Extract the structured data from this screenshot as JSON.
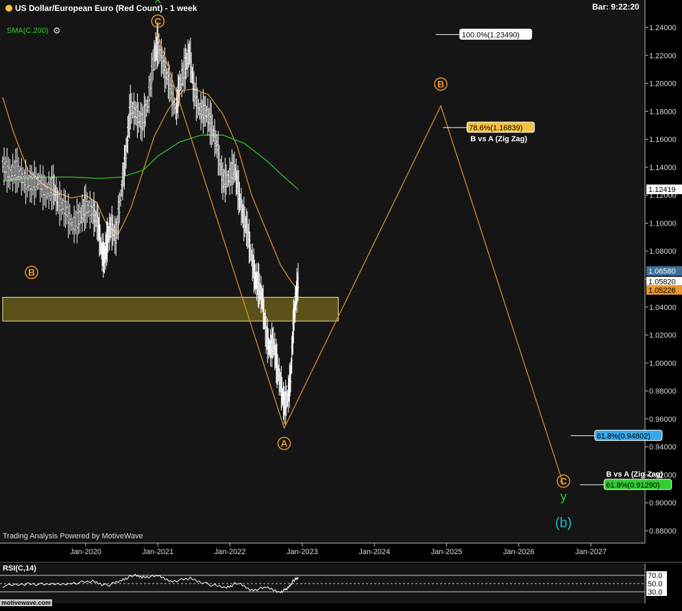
{
  "header": {
    "title": "US Dollar/European Euro (Red Count) - 1 week",
    "bar_time": "Bar: 9:22:20",
    "sma_label": "SMA(C,200)",
    "credit": "Trading Analysis Powered by MotiveWave",
    "logo": "motivewave.com"
  },
  "colors": {
    "background": "#151515",
    "price_bars": "#ffffff",
    "orange_ma": "#e8962e",
    "sma200": "#2db82d",
    "wave_lines": "#e8962e",
    "zone_fill": "#5a5218",
    "zone_border": "#f0e890",
    "accent_green": "#33cc33",
    "accent_cyan": "#22b8c8"
  },
  "chart_data": {
    "type": "line",
    "x_axis_ticks": [
      "Jan-2020",
      "Jan-2021",
      "Jan-2022",
      "Jan-2023",
      "Jan-2024",
      "Jan-2025",
      "Jan-2026",
      "Jan-2027"
    ],
    "y_axis_ticks": [
      "0.88000",
      "0.90000",
      "0.92000",
      "0.94000",
      "0.96000",
      "0.98000",
      "1.00000",
      "1.02000",
      "1.04000",
      "1.06000",
      "1.08000",
      "1.10000",
      "1.12000",
      "1.14000",
      "1.16000",
      "1.18000",
      "1.20000",
      "1.22000",
      "1.24000"
    ],
    "ylim": [
      0.868,
      1.258
    ],
    "price_tags": [
      {
        "label": "1.12419",
        "value": 1.12419,
        "bg": "#ffffff",
        "fg": "#000000"
      },
      {
        "label": "1.06580",
        "value": 1.0658,
        "bg": "#3a6f9a",
        "fg": "#ffffff"
      },
      {
        "label": "1.05820",
        "value": 1.0582,
        "bg": "#ffffff",
        "fg": "#000000"
      },
      {
        "label": "1.05226",
        "value": 1.05226,
        "bg": "#e8962e",
        "fg": "#000000"
      }
    ],
    "wave_path": [
      {
        "date": 2021.0,
        "value": 1.2349
      },
      {
        "date": 2022.75,
        "value": 0.9535
      },
      {
        "date": 2024.92,
        "value": 1.1839
      },
      {
        "date": 2026.62,
        "value": 0.9129
      }
    ],
    "wave_labels": [
      {
        "text": "C",
        "date": 2021.0,
        "value": 1.2445,
        "pos": "above"
      },
      {
        "text": "B",
        "date": 2019.25,
        "value": 1.0648,
        "pos": "below"
      },
      {
        "text": "A",
        "date": 2022.75,
        "value": 0.9425,
        "pos": "below"
      },
      {
        "text": "B",
        "date": 2024.92,
        "value": 1.1995,
        "pos": "above"
      },
      {
        "text": "C",
        "date": 2026.62,
        "value": 0.9155,
        "pos": "below"
      }
    ],
    "degree_labels": [
      {
        "text": "x",
        "date": 2021.0,
        "value": 1.2575,
        "color": "#33cc33",
        "size": 18
      },
      {
        "text": "y",
        "date": 2026.62,
        "value": 0.9015,
        "color": "#33cc33",
        "size": 18
      },
      {
        "text": "(b)",
        "date": 2026.62,
        "value": 0.8825,
        "color": "#22b8c8",
        "size": 20
      }
    ],
    "fib_levels": [
      {
        "label": "100.0%(1.23490)",
        "value": 1.2349,
        "date_from": 2024.85,
        "box_bg": "#ffffff",
        "box_fg": "#000000",
        "note": ""
      },
      {
        "label": "78.6%(1.16839)",
        "value": 1.16839,
        "date_from": 2024.95,
        "box_bg": "#f5c242",
        "box_fg": "#000000",
        "note": "B vs A (Zig Zag)"
      },
      {
        "label": "61.8%(0.94802)",
        "value": 0.94802,
        "date_from": 2026.72,
        "box_bg": "#39a8e8",
        "box_fg": "#000000",
        "note": ""
      },
      {
        "label": "61.8%(0.91290)",
        "value": 0.9129,
        "date_from": 2026.85,
        "box_bg": "#33cc33",
        "box_fg": "#000000",
        "note": "B vs A (Zig Zag)"
      }
    ],
    "support_zone": {
      "low": 1.03,
      "high": 1.047,
      "date_from": 2018.85,
      "date_to": 2023.5
    },
    "price_series": [
      {
        "date": 2018.85,
        "value": 1.142
      },
      {
        "date": 2018.95,
        "value": 1.135
      },
      {
        "date": 2019.05,
        "value": 1.138
      },
      {
        "date": 2019.15,
        "value": 1.13
      },
      {
        "date": 2019.25,
        "value": 1.128
      },
      {
        "date": 2019.35,
        "value": 1.13
      },
      {
        "date": 2019.45,
        "value": 1.122
      },
      {
        "date": 2019.55,
        "value": 1.126
      },
      {
        "date": 2019.62,
        "value": 1.115
      },
      {
        "date": 2019.72,
        "value": 1.11
      },
      {
        "date": 2019.82,
        "value": 1.098
      },
      {
        "date": 2019.92,
        "value": 1.104
      },
      {
        "date": 2020.0,
        "value": 1.112
      },
      {
        "date": 2020.1,
        "value": 1.108
      },
      {
        "date": 2020.17,
        "value": 1.1
      },
      {
        "date": 2020.22,
        "value": 1.08
      },
      {
        "date": 2020.26,
        "value": 1.075
      },
      {
        "date": 2020.3,
        "value": 1.088
      },
      {
        "date": 2020.35,
        "value": 1.098
      },
      {
        "date": 2020.42,
        "value": 1.09
      },
      {
        "date": 2020.5,
        "value": 1.125
      },
      {
        "date": 2020.56,
        "value": 1.15
      },
      {
        "date": 2020.62,
        "value": 1.183
      },
      {
        "date": 2020.7,
        "value": 1.178
      },
      {
        "date": 2020.78,
        "value": 1.172
      },
      {
        "date": 2020.86,
        "value": 1.185
      },
      {
        "date": 2020.95,
        "value": 1.22
      },
      {
        "date": 2021.0,
        "value": 1.228
      },
      {
        "date": 2021.08,
        "value": 1.212
      },
      {
        "date": 2021.16,
        "value": 1.2
      },
      {
        "date": 2021.25,
        "value": 1.18
      },
      {
        "date": 2021.3,
        "value": 1.198
      },
      {
        "date": 2021.38,
        "value": 1.212
      },
      {
        "date": 2021.44,
        "value": 1.222
      },
      {
        "date": 2021.5,
        "value": 1.195
      },
      {
        "date": 2021.58,
        "value": 1.18
      },
      {
        "date": 2021.66,
        "value": 1.18
      },
      {
        "date": 2021.74,
        "value": 1.17
      },
      {
        "date": 2021.82,
        "value": 1.155
      },
      {
        "date": 2021.9,
        "value": 1.13
      },
      {
        "date": 2021.98,
        "value": 1.132
      },
      {
        "date": 2022.06,
        "value": 1.14
      },
      {
        "date": 2022.12,
        "value": 1.122
      },
      {
        "date": 2022.18,
        "value": 1.105
      },
      {
        "date": 2022.24,
        "value": 1.095
      },
      {
        "date": 2022.3,
        "value": 1.075
      },
      {
        "date": 2022.35,
        "value": 1.06
      },
      {
        "date": 2022.4,
        "value": 1.055
      },
      {
        "date": 2022.45,
        "value": 1.045
      },
      {
        "date": 2022.5,
        "value": 1.02
      },
      {
        "date": 2022.55,
        "value": 1.01
      },
      {
        "date": 2022.6,
        "value": 1.015
      },
      {
        "date": 2022.65,
        "value": 0.998
      },
      {
        "date": 2022.7,
        "value": 0.985
      },
      {
        "date": 2022.75,
        "value": 0.97
      },
      {
        "date": 2022.8,
        "value": 0.975
      },
      {
        "date": 2022.84,
        "value": 0.99
      },
      {
        "date": 2022.88,
        "value": 1.03
      },
      {
        "date": 2022.92,
        "value": 1.05
      },
      {
        "date": 2022.95,
        "value": 1.06
      }
    ],
    "ma_orange": [
      {
        "date": 2018.85,
        "value": 1.19
      },
      {
        "date": 2019.0,
        "value": 1.165
      },
      {
        "date": 2019.2,
        "value": 1.138
      },
      {
        "date": 2019.4,
        "value": 1.128
      },
      {
        "date": 2019.6,
        "value": 1.122
      },
      {
        "date": 2019.8,
        "value": 1.118
      },
      {
        "date": 2020.0,
        "value": 1.12
      },
      {
        "date": 2020.15,
        "value": 1.115
      },
      {
        "date": 2020.3,
        "value": 1.098
      },
      {
        "date": 2020.45,
        "value": 1.092
      },
      {
        "date": 2020.62,
        "value": 1.11
      },
      {
        "date": 2020.8,
        "value": 1.138
      },
      {
        "date": 2020.95,
        "value": 1.162
      },
      {
        "date": 2021.15,
        "value": 1.182
      },
      {
        "date": 2021.35,
        "value": 1.195
      },
      {
        "date": 2021.5,
        "value": 1.196
      },
      {
        "date": 2021.7,
        "value": 1.192
      },
      {
        "date": 2021.9,
        "value": 1.178
      },
      {
        "date": 2022.1,
        "value": 1.155
      },
      {
        "date": 2022.3,
        "value": 1.12
      },
      {
        "date": 2022.5,
        "value": 1.095
      },
      {
        "date": 2022.7,
        "value": 1.07
      },
      {
        "date": 2022.85,
        "value": 1.058
      },
      {
        "date": 2022.95,
        "value": 1.052
      }
    ],
    "sma200": [
      {
        "date": 2018.85,
        "value": 1.13
      },
      {
        "date": 2019.3,
        "value": 1.133
      },
      {
        "date": 2019.8,
        "value": 1.133
      },
      {
        "date": 2020.2,
        "value": 1.132
      },
      {
        "date": 2020.5,
        "value": 1.133
      },
      {
        "date": 2020.8,
        "value": 1.138
      },
      {
        "date": 2021.0,
        "value": 1.148
      },
      {
        "date": 2021.3,
        "value": 1.158
      },
      {
        "date": 2021.6,
        "value": 1.163
      },
      {
        "date": 2021.9,
        "value": 1.163
      },
      {
        "date": 2022.2,
        "value": 1.157
      },
      {
        "date": 2022.5,
        "value": 1.145
      },
      {
        "date": 2022.75,
        "value": 1.133
      },
      {
        "date": 2022.95,
        "value": 1.124
      }
    ],
    "rsi": {
      "label": "RSI(C,14)",
      "y_ticks": [
        "70.0",
        "50.0",
        "30.0"
      ],
      "values": [
        {
          "date": 2018.85,
          "value": 44
        },
        {
          "date": 2019.2,
          "value": 50
        },
        {
          "date": 2019.5,
          "value": 47
        },
        {
          "date": 2019.8,
          "value": 51
        },
        {
          "date": 2020.1,
          "value": 55
        },
        {
          "date": 2020.3,
          "value": 45
        },
        {
          "date": 2020.5,
          "value": 58
        },
        {
          "date": 2020.65,
          "value": 70
        },
        {
          "date": 2020.8,
          "value": 66
        },
        {
          "date": 2021.0,
          "value": 68
        },
        {
          "date": 2021.2,
          "value": 56
        },
        {
          "date": 2021.45,
          "value": 62
        },
        {
          "date": 2021.7,
          "value": 48
        },
        {
          "date": 2021.95,
          "value": 40
        },
        {
          "date": 2022.1,
          "value": 52
        },
        {
          "date": 2022.3,
          "value": 34
        },
        {
          "date": 2022.5,
          "value": 40
        },
        {
          "date": 2022.7,
          "value": 30
        },
        {
          "date": 2022.8,
          "value": 38
        },
        {
          "date": 2022.88,
          "value": 58
        },
        {
          "date": 2022.95,
          "value": 64
        }
      ]
    }
  }
}
